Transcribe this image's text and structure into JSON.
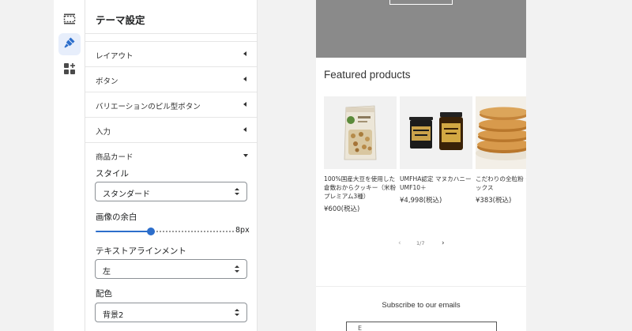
{
  "panel": {
    "title": "テーマ設定",
    "sections": [
      {
        "label": "レイアウト",
        "expanded": false
      },
      {
        "label": "ボタン",
        "expanded": false
      },
      {
        "label": "バリエーションのピル型ボタン",
        "expanded": false
      },
      {
        "label": "入力",
        "expanded": false
      },
      {
        "label": "商品カード",
        "expanded": true
      }
    ],
    "product_card": {
      "style_label": "スタイル",
      "style_value": "スタンダード",
      "image_padding_label": "画像の余白",
      "image_padding_value": "8px",
      "image_padding_fraction": 0.4,
      "text_alignment_label": "テキストアラインメント",
      "text_alignment_value": "左",
      "color_scheme_label": "配色",
      "color_scheme_value": "背景2"
    }
  },
  "rail": {
    "icons": [
      "sections-icon",
      "theme-settings-icon",
      "app-blocks-icon"
    ],
    "active": "theme-settings-icon"
  },
  "preview": {
    "section_title": "Featured products",
    "products": [
      {
        "name": "100%国産大豆を使用した倉敷おからクッキー（米粉プレミアム3種）",
        "price": "¥600(税込)"
      },
      {
        "name": "UMFHA認定 マヌカハニー UMF10＋",
        "price": "¥4,998(税込)"
      },
      {
        "name": "こだわりの全粒粉 ーキミックス",
        "price": "¥383(税込)"
      }
    ],
    "pagination": {
      "current": "1/7",
      "prev": "‹",
      "next": "›"
    },
    "subscribe_title": "Subscribe to our emails",
    "email_placeholder": "E"
  },
  "colors": {
    "accent": "#2c6ecb",
    "hero_bg": "#8a8a8a"
  }
}
